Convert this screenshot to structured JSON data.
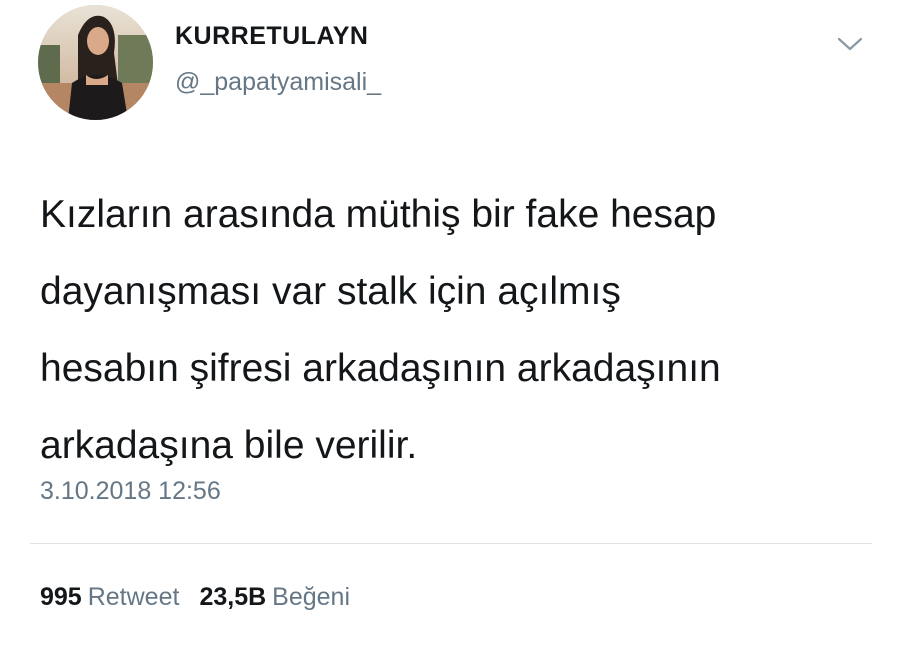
{
  "user": {
    "display_name": "KURRETULAYN",
    "handle": "@_papatyamisali_",
    "avatar_icon": "profile-photo"
  },
  "menu": {
    "icon": "chevron-down-icon"
  },
  "tweet": {
    "lines": [
      "Kızların arasında müthiş bir fake hesap",
      "dayanışması var stalk için açılmış",
      "hesabın şifresi arkadaşının arkadaşının",
      "arkadaşına bile verilir."
    ],
    "timestamp": "3.10.2018 12:56"
  },
  "stats": {
    "retweets": {
      "count": "995",
      "label": "Retweet"
    },
    "likes": {
      "count": "23,5B",
      "label": "Beğeni"
    }
  },
  "colors": {
    "text": "#14171a",
    "secondary": "#657786",
    "divider": "#dfe3e7"
  }
}
